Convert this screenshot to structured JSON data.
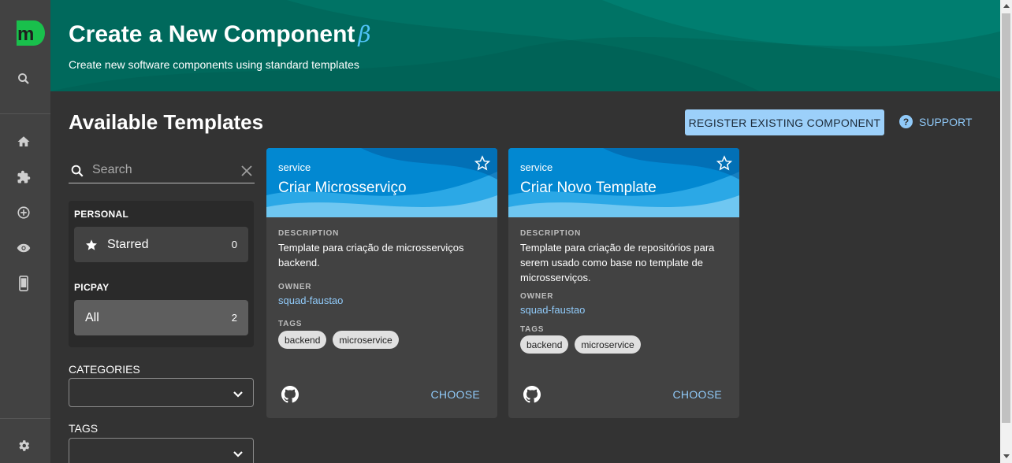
{
  "header": {
    "title": "Create a New Component",
    "beta": "β",
    "subtitle": "Create new software components using standard templates"
  },
  "main": {
    "section_title": "Available Templates",
    "register_button": "REGISTER EXISTING COMPONENT",
    "support_label": "SUPPORT"
  },
  "search": {
    "placeholder": "Search"
  },
  "filters": {
    "personal_heading": "PERSONAL",
    "starred_label": "Starred",
    "starred_count": "0",
    "org_heading": "PICPAY",
    "all_label": "All",
    "all_count": "2",
    "categories_label": "CATEGORIES",
    "tags_label": "TAGS"
  },
  "cards": [
    {
      "type": "service",
      "title": "Criar Microsserviço",
      "description_label": "DESCRIPTION",
      "description": "Template para criação de microsserviços backend.",
      "owner_label": "OWNER",
      "owner": "squad-faustao",
      "tags_label": "TAGS",
      "tags": [
        "backend",
        "microservice"
      ],
      "choose": "CHOOSE"
    },
    {
      "type": "service",
      "title": "Criar Novo Template",
      "description_label": "DESCRIPTION",
      "description": "Template para criação de repositórios para serem usado como base no template de microsserviços.",
      "owner_label": "OWNER",
      "owner": "squad-faustao",
      "tags_label": "TAGS",
      "tags": [
        "backend",
        "microservice"
      ],
      "choose": "CHOOSE"
    }
  ],
  "sidebar": {
    "icons": [
      "logo-icon",
      "search-icon",
      "home-icon",
      "puzzle-icon",
      "add-circle-icon",
      "eye-icon",
      "mobile-icon",
      "settings-icon"
    ]
  },
  "colors": {
    "header_bg": "#00695c",
    "accent": "#90caf9",
    "button_bg": "#9cd0fa",
    "logo_green": "#19c04c",
    "card_head": "#0277bd"
  }
}
